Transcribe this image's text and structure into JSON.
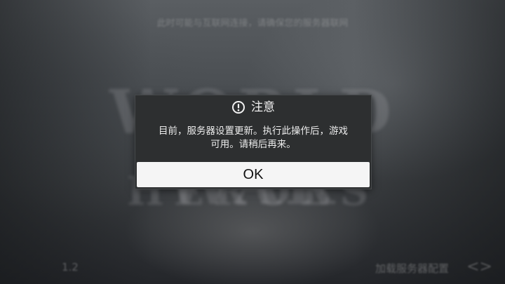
{
  "background": {
    "notice": "此时可能与互联网连接，请确保您的服务器联网",
    "logo_top": "WORLD WAR",
    "logo_bottom": "HEROES",
    "version": "1.2",
    "loading_text": "加载服务器配置",
    "brand": "<>"
  },
  "dialog": {
    "icon": "alert-circle-icon",
    "title": "注意",
    "message_line1": "目前，服务器设置更新。执行此操作后，游戏",
    "message_line2": "可用。请稍后再来。",
    "ok_label": "OK"
  },
  "colors": {
    "dialog_background": "#2d2f30",
    "button_background": "#f5f5f5",
    "text_light": "#f2f2f2"
  }
}
